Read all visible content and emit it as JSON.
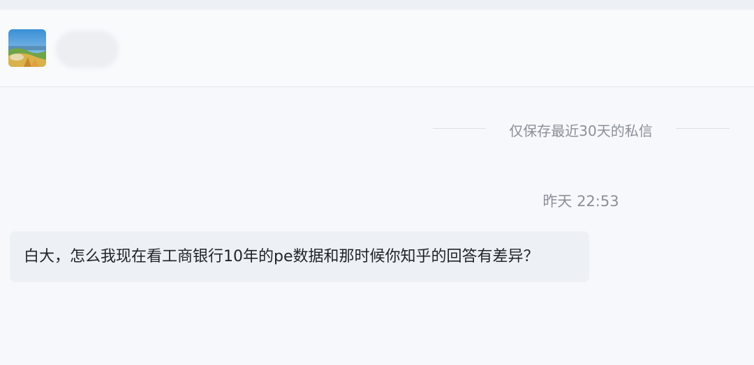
{
  "header": {
    "avatar_icon": "landscape-avatar-icon",
    "contact_name": ""
  },
  "chat": {
    "retention_notice": "仅保存最近30天的私信",
    "timestamp": "昨天 22:53",
    "messages": [
      {
        "text": "白大，怎么我现在看工商银行10年的pe数据和那时候你知乎的回答有差异？"
      }
    ]
  },
  "colors": {
    "page_bg": "#f4f6f9",
    "header_bg": "#f9fafc",
    "bubble_bg": "#edf0f4",
    "muted_text": "#8a8f99",
    "message_text": "#1f2329"
  }
}
